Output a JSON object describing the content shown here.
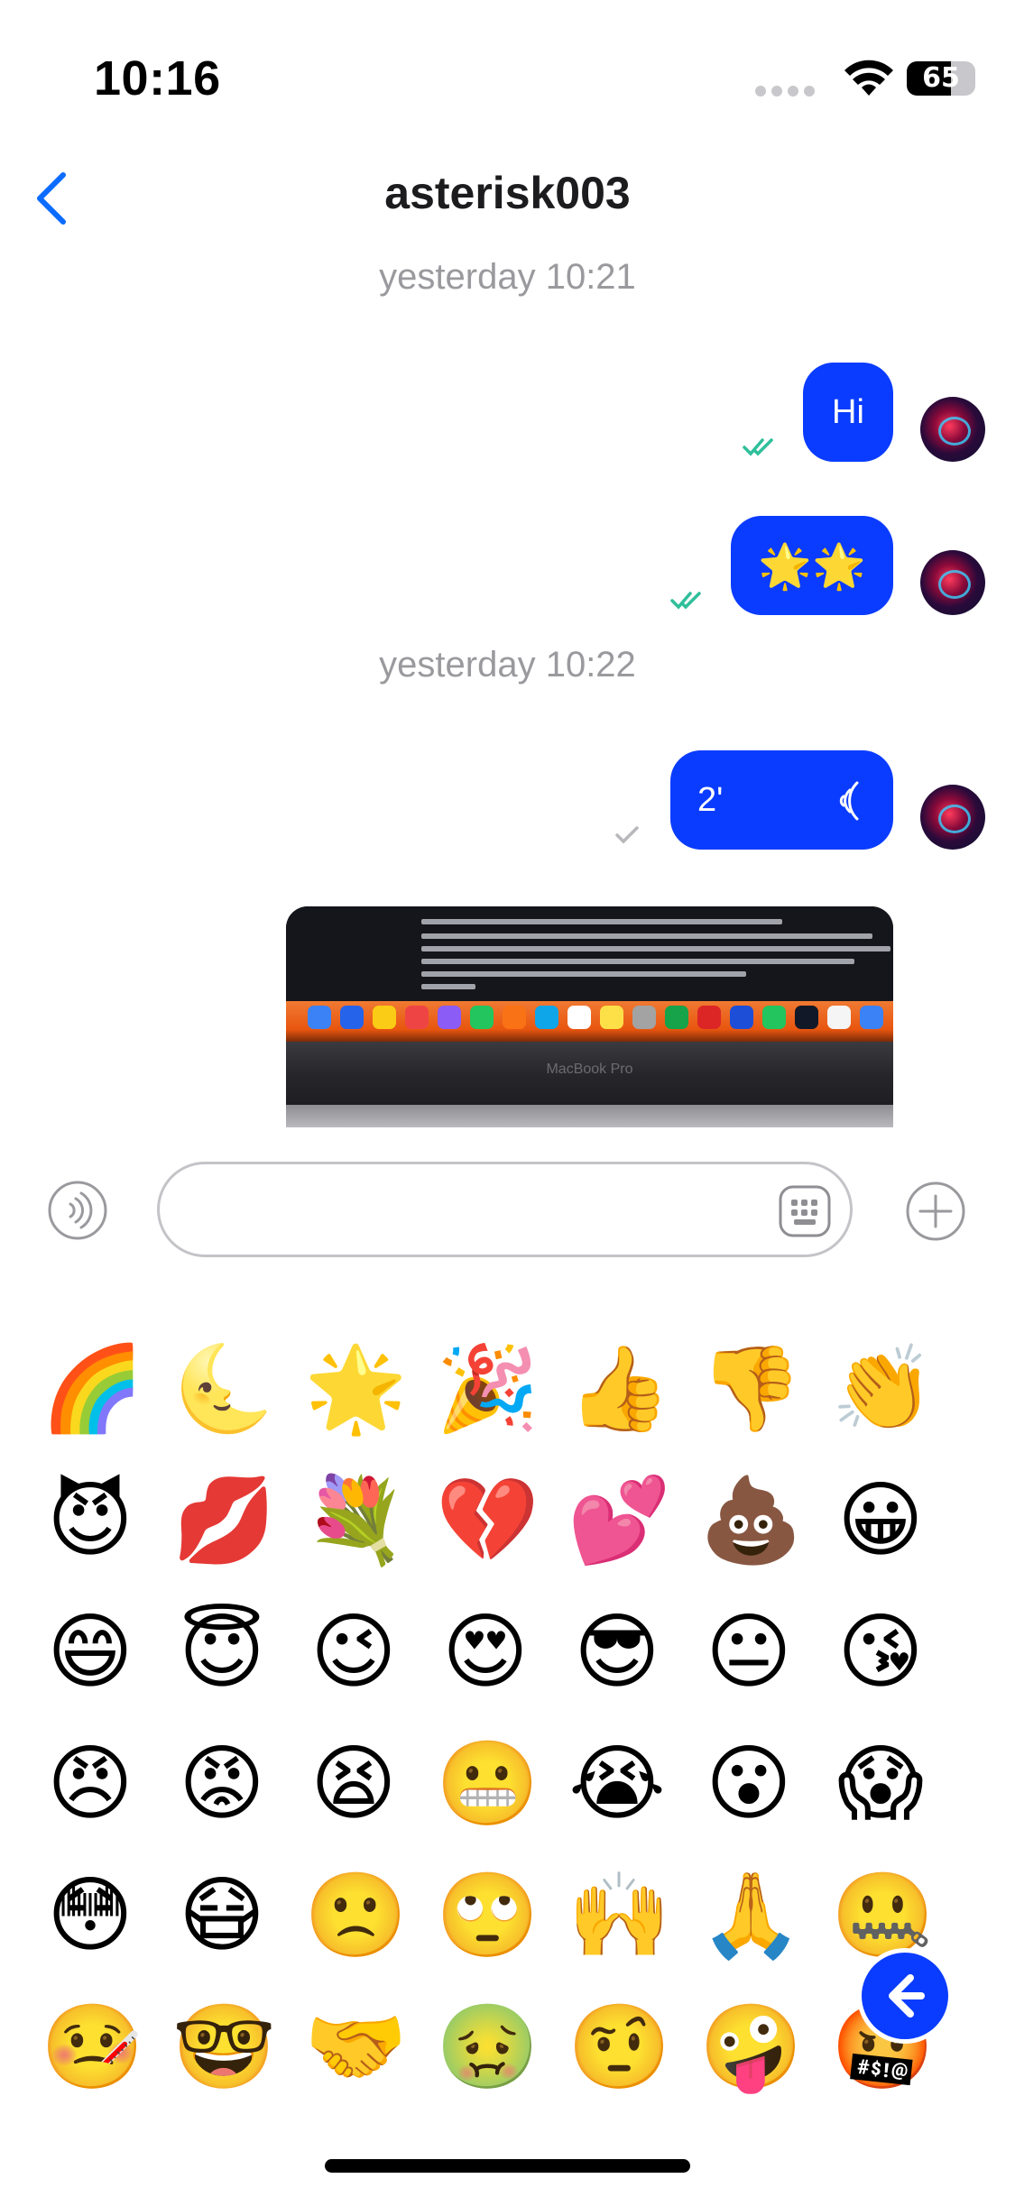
{
  "status_bar": {
    "time": "10:16",
    "battery": "65",
    "battery_level": 0.65
  },
  "nav": {
    "title": "asterisk003",
    "back_icon": "chevron-left-icon"
  },
  "messages": [
    {
      "type": "timestamp",
      "text": "yesterday 10:21"
    },
    {
      "type": "text",
      "text": "Hi",
      "status": "read"
    },
    {
      "type": "text",
      "text": "🌟🌟",
      "status": "read"
    },
    {
      "type": "timestamp",
      "text": "yesterday 10:22"
    },
    {
      "type": "voice",
      "duration": "2'",
      "status": "sent"
    },
    {
      "type": "image",
      "caption": "MacBook Pro"
    }
  ],
  "input": {
    "placeholder": "",
    "value": "",
    "mic_icon": "voice-icon",
    "keyboard_icon": "keyboard-icon",
    "add_icon": "plus-circle-icon"
  },
  "emoji_rows": [
    [
      "🌈",
      "🌜",
      "🌟",
      "🎉",
      "👍",
      "👎",
      "👏"
    ],
    [
      "😈",
      "💋",
      "💐",
      "💔",
      "💕",
      "💩",
      "😀"
    ],
    [
      "😄",
      "😇",
      "😉",
      "😍",
      "😎",
      "😐",
      "😘"
    ],
    [
      "😠",
      "😡",
      "😫",
      "😬",
      "😭",
      "😮",
      "😱"
    ],
    [
      "😳",
      "😷",
      "🙁",
      "🙄",
      "🙌",
      "🙏",
      "🤐"
    ],
    [
      "🤒",
      "🤓",
      "🤝",
      "🤢",
      "🤨",
      "🤪",
      "🤬"
    ]
  ],
  "colors": {
    "accent": "#0a3cff",
    "check": "#2fbf9a",
    "timestamp": "#9a9a9e"
  }
}
